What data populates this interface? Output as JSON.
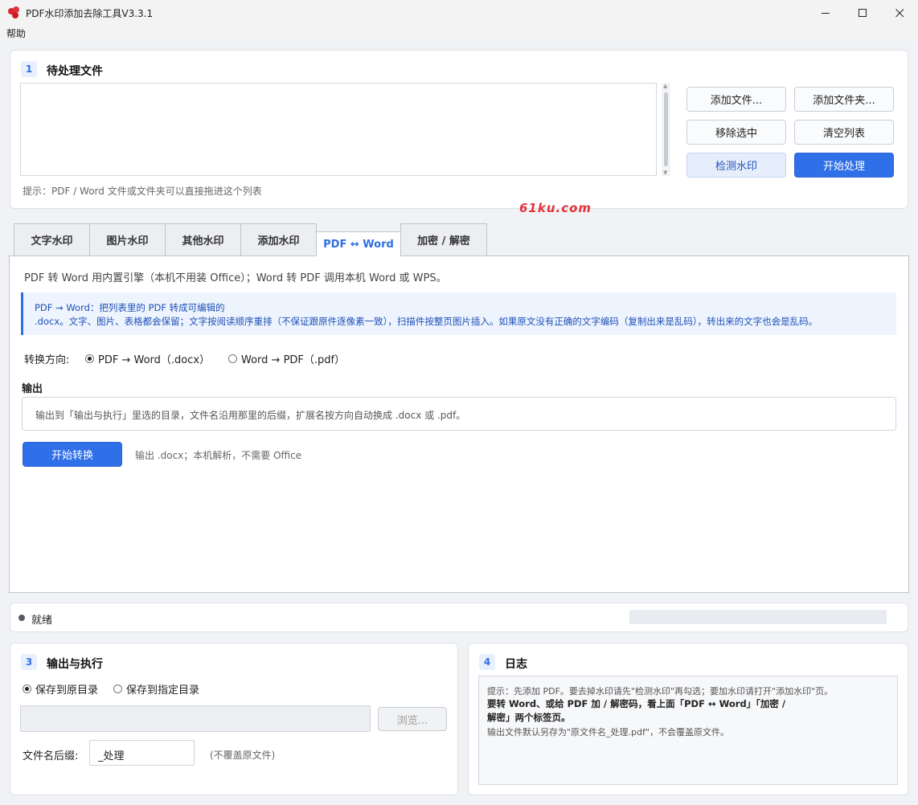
{
  "window": {
    "title": "PDF水印添加去除工具V3.3.1",
    "minimize_icon": "minimize-icon",
    "maximize_icon": "maximize-icon",
    "close_icon": "close-icon"
  },
  "menu": {
    "help": "帮助"
  },
  "files": {
    "badge": "1",
    "title": "待处理文件",
    "hint": "提示：PDF / Word 文件或文件夹可以直接拖进这个列表",
    "buttons": {
      "add_file": "添加文件...",
      "add_folder": "添加文件夹...",
      "remove_selected": "移除选中",
      "clear_list": "清空列表",
      "detect_watermark": "检测水印",
      "start_process": "开始处理"
    }
  },
  "watermark_text": "61ku.com",
  "tabs": [
    {
      "label": "文字水印"
    },
    {
      "label": "图片水印"
    },
    {
      "label": "其他水印"
    },
    {
      "label": "添加水印"
    },
    {
      "label": "PDF ↔ Word"
    },
    {
      "label": "加密 / 解密"
    }
  ],
  "convert": {
    "intro": "PDF 转 Word 用内置引擎（本机不用装 Office）；Word 转 PDF 调用本机 Word 或 WPS。",
    "info_line1": "PDF → Word：把列表里的 PDF 转成可编辑的",
    "info_line2": ".docx。文字、图片、表格都会保留；文字按阅读顺序重排（不保证跟原件逐像素一致），扫描件按整页图片插入。如果原文没有正确的文字编码（复制出来是乱码），转出来的文字也会是乱码。",
    "direction_label": "转换方向:",
    "option_pdf_word": "PDF → Word（.docx）",
    "option_word_pdf": "Word → PDF（.pdf）",
    "output_label": "输出",
    "output_desc": "输出到「输出与执行」里选的目录，文件名沿用那里的后缀，扩展名按方向自动换成 .docx 或 .pdf。",
    "start_button": "开始转换",
    "start_hint": "输出 .docx；本机解析，不需要 Office"
  },
  "status": {
    "text": "就绪",
    "progress": 0
  },
  "output": {
    "badge": "3",
    "title": "输出与执行",
    "save_original": "保存到原目录",
    "save_custom": "保存到指定目录",
    "path_value": "",
    "browse": "浏览...",
    "suffix_label": "文件名后缀:",
    "suffix_value": "_处理",
    "suffix_note": "(不覆盖原文件)"
  },
  "log": {
    "badge": "4",
    "title": "日志",
    "line1": "提示：先添加 PDF。要去掉水印请先\"检测水印\"再勾选；要加水印请打开\"添加水印\"页。",
    "line2a": "要转 Word、或给 PDF 加 / 解密码，看上面「PDF ↔ Word」「加密 /",
    "line2b": "解密」两个标签页。",
    "line3": "输出文件默认另存为\"原文件名_处理.pdf\"，不会覆盖原文件。"
  },
  "colors": {
    "accent": "#2f6fe8",
    "watermark": "#e5323a"
  }
}
